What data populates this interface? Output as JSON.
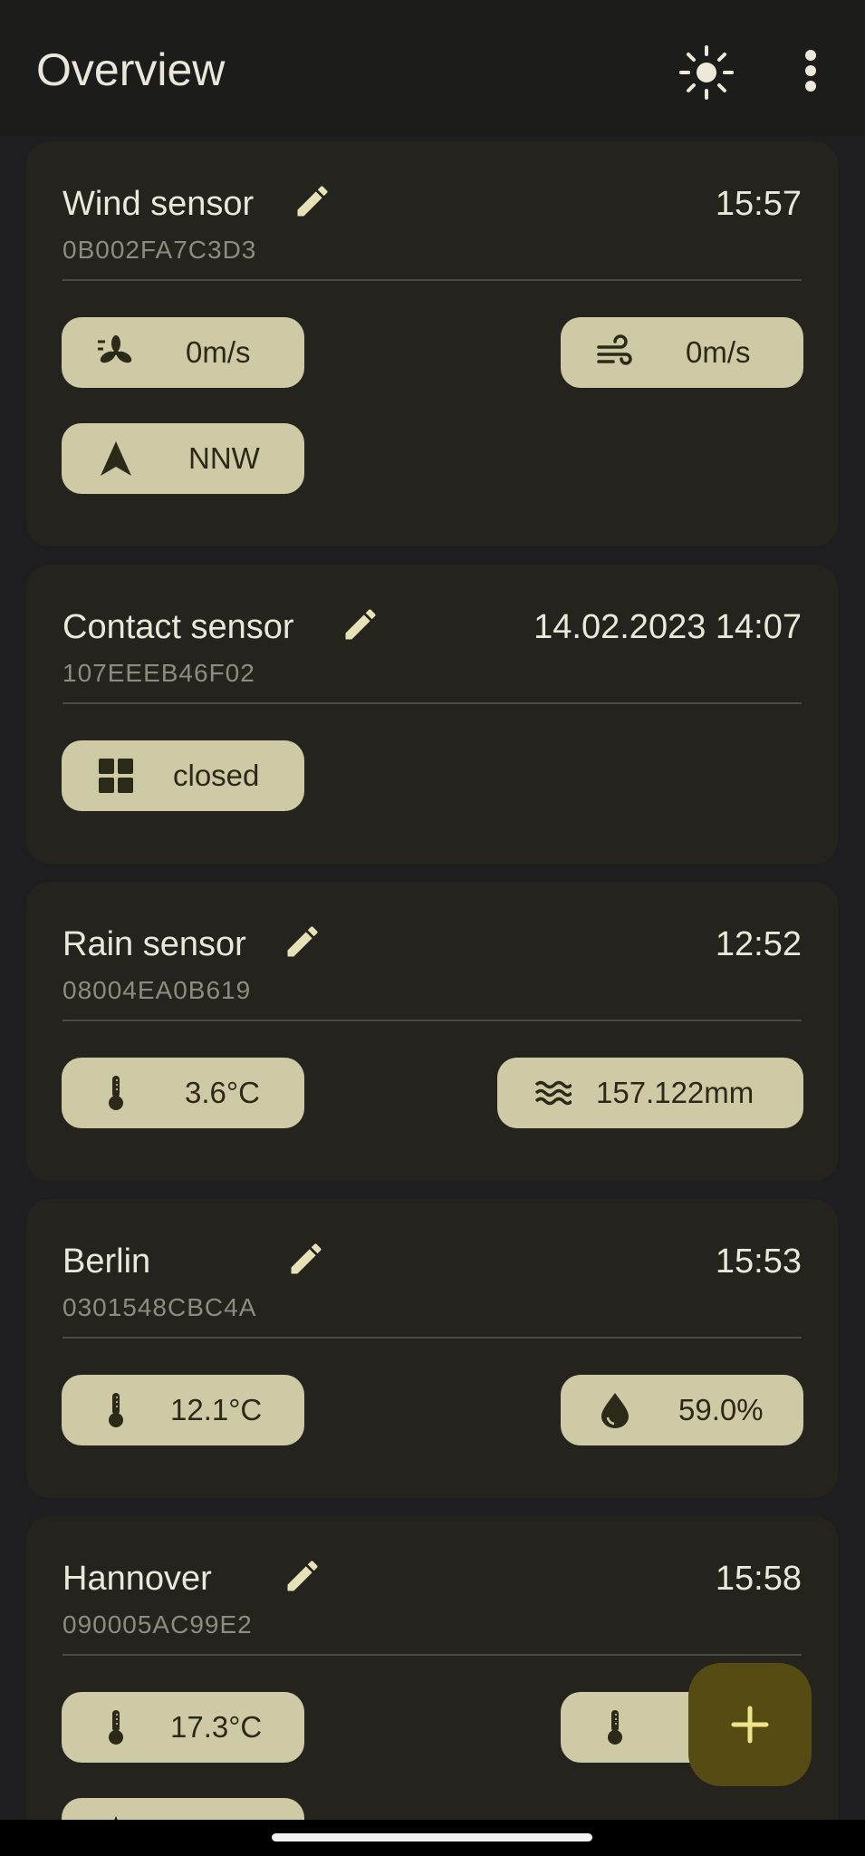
{
  "appbar": {
    "title": "Overview",
    "theme_icon": "sun-icon",
    "menu_icon": "more-vert-icon"
  },
  "cards": [
    {
      "name": "Wind sensor",
      "id": "0B002FA7C3D3",
      "time": "15:57",
      "chips": [
        {
          "icon": "fan-icon",
          "value": "0m/s"
        },
        {
          "icon": "wind-icon",
          "value": "0m/s"
        },
        {
          "icon": "navigation-arrow-icon",
          "value": "NNW"
        }
      ]
    },
    {
      "name": "Contact sensor",
      "id": "107EEEB46F02",
      "time": "14.02.2023 14:07",
      "chips": [
        {
          "icon": "window-icon",
          "value": "closed"
        }
      ]
    },
    {
      "name": "Rain sensor",
      "id": "08004EA0B619",
      "time": "12:52",
      "chips": [
        {
          "icon": "thermometer-icon",
          "value": "3.6°C"
        },
        {
          "icon": "waves-icon",
          "value": "157.122mm"
        }
      ]
    },
    {
      "name": "Berlin",
      "id": "0301548CBC4A",
      "time": "15:53",
      "chips": [
        {
          "icon": "thermometer-icon",
          "value": "12.1°C"
        },
        {
          "icon": "water-drop-icon",
          "value": "59.0%"
        }
      ]
    },
    {
      "name": "Hannover",
      "id": "090005AC99E2",
      "time": "15:58",
      "chips": [
        {
          "icon": "thermometer-icon",
          "value": "17.3°C"
        },
        {
          "icon": "thermometer-icon",
          "value": ""
        }
      ]
    }
  ],
  "fab": {
    "label": "+",
    "icon": "add-icon"
  },
  "colors": {
    "background": "#1e1e20",
    "card": "#25231d",
    "chip": "#cfcaa6",
    "fab": "#544c12",
    "accent": "#f0e48a"
  }
}
